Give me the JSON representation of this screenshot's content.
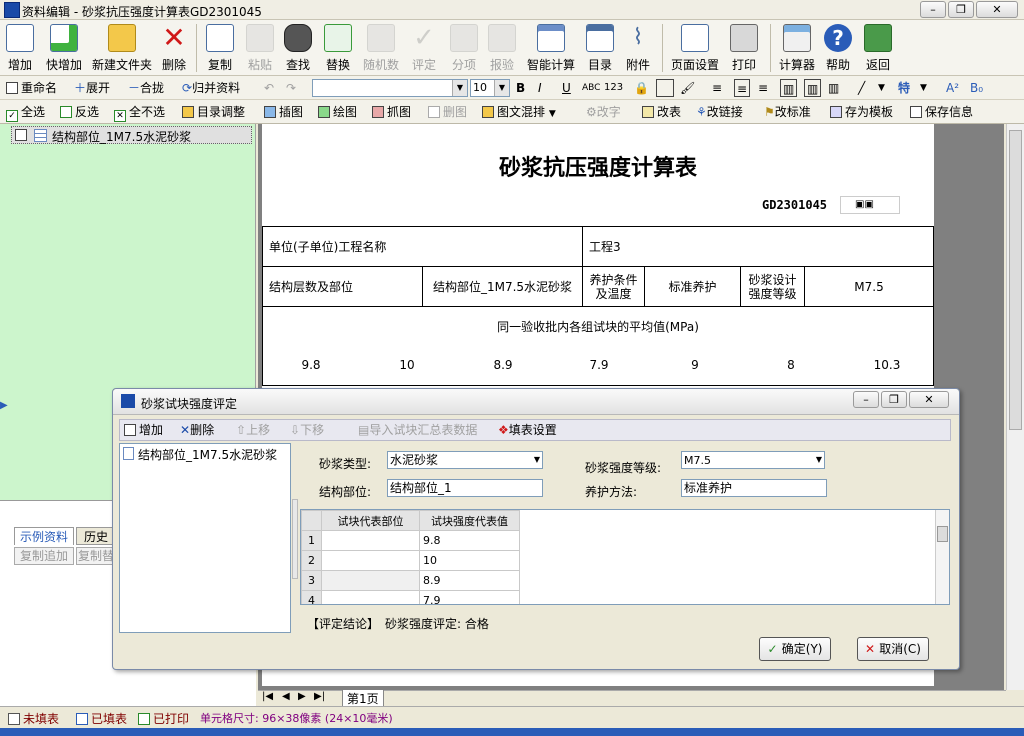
{
  "window": {
    "title": "资料编辑 - 砂浆抗压强度计算表GD2301045"
  },
  "toolbar_main": [
    {
      "label": "增加",
      "icon": "add-doc-icon"
    },
    {
      "label": "快增加",
      "icon": "quick-add-icon"
    },
    {
      "label": "新建文件夹",
      "icon": "folder-icon"
    },
    {
      "label": "删除",
      "icon": "delete-icon"
    },
    {
      "label": "复制",
      "icon": "copy-icon"
    },
    {
      "label": "粘贴",
      "icon": "paste-icon"
    },
    {
      "label": "查找",
      "icon": "binoculars-icon"
    },
    {
      "label": "替换",
      "icon": "replace-icon"
    },
    {
      "label": "随机数",
      "icon": "random-icon"
    },
    {
      "label": "评定",
      "icon": "check-icon"
    },
    {
      "label": "分项",
      "icon": "tree-icon"
    },
    {
      "label": "报验",
      "icon": "report-icon"
    },
    {
      "label": "智能计算",
      "icon": "calc-grid-icon"
    },
    {
      "label": "目录",
      "icon": "catalog-icon"
    },
    {
      "label": "附件",
      "icon": "paperclip-icon"
    },
    {
      "label": "页面设置",
      "icon": "page-setup-icon"
    },
    {
      "label": "打印",
      "icon": "printer-icon"
    },
    {
      "label": "计算器",
      "icon": "calculator-icon"
    },
    {
      "label": "帮助",
      "icon": "help-icon"
    },
    {
      "label": "返回",
      "icon": "exit-door-icon"
    }
  ],
  "row2": {
    "rename": "重命名",
    "expand": "展开",
    "collapse": "合拢",
    "merge": "归并资料",
    "font_size": "10"
  },
  "row3": {
    "select_all": "全选",
    "invert": "反选",
    "select_none": "全不选",
    "catalog_adjust": "目录调整",
    "insert_image": "插图",
    "draw": "绘图",
    "capture": "抓图",
    "delete_image": "删图",
    "text_mix": "图文混排",
    "change_font": "改字",
    "change_table": "改表",
    "change_link": "改链接",
    "change_std": "改标准",
    "save_template": "存为模板",
    "save_info": "保存信息"
  },
  "tree": {
    "item": "结构部位_1M7.5水泥砂浆"
  },
  "left_tabs": {
    "tab1": "示例资料",
    "tab2": "历史",
    "btn1": "复制追加",
    "btn2": "复制替"
  },
  "document": {
    "title": "砂浆抗压强度计算表",
    "code": "GD2301045",
    "project_label": "单位(子单位)工程名称",
    "project_value": "工程3",
    "struct_label": "结构层数及部位",
    "struct_value": "结构部位_1M7.5水泥砂浆",
    "cure_label": "养护条件及温度",
    "cure_value": "标准养护",
    "grade_label": "砂浆设计强度等级",
    "grade_value": "M7.5",
    "avg_label": "同一验收批内各组试块的平均值(MPa)",
    "values": [
      "9.8",
      "10",
      "8.9",
      "7.9",
      "9",
      "8",
      "10.3"
    ]
  },
  "dialog": {
    "title": "砂浆试块强度评定",
    "add": "增加",
    "delete": "删除",
    "move_up": "上移",
    "move_down": "下移",
    "import": "导入试块汇总表数据",
    "settings": "填表设置",
    "tree_item": "结构部位_1M7.5水泥砂浆",
    "mortar_type_label": "砂浆类型:",
    "mortar_type_value": "水泥砂浆",
    "grade_label": "砂浆强度等级:",
    "grade_value": "M7.5",
    "struct_label": "结构部位:",
    "struct_value": "结构部位_1",
    "cure_label": "养护方法:",
    "cure_value": "标准养护",
    "col1": "试块代表部位",
    "col2": "试块强度代表值",
    "rows": [
      {
        "n": "1",
        "part": "",
        "val": "9.8"
      },
      {
        "n": "2",
        "part": "",
        "val": "10"
      },
      {
        "n": "3",
        "part": "",
        "val": "8.9"
      },
      {
        "n": "4",
        "part": "",
        "val": "7.9"
      }
    ],
    "conclusion_label": "【评定结论】",
    "conclusion": "砂浆强度评定: 合格",
    "ok": "确定(Y)",
    "cancel": "取消(C)"
  },
  "page_tab": "第1页",
  "status": {
    "unfilled": "未填表",
    "filled": "已填表",
    "printed": "已打印",
    "cell_size": "单元格尺寸: 96×38像素 (24×10毫米)"
  }
}
